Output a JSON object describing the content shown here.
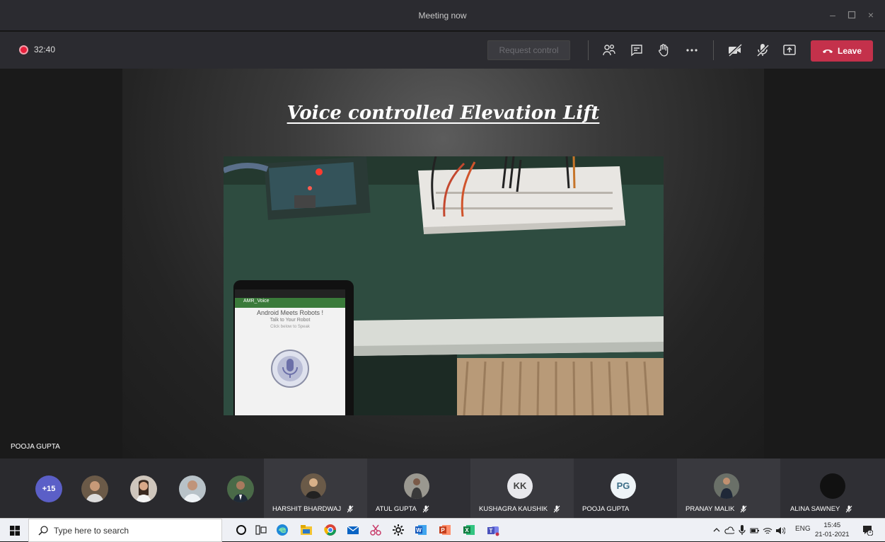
{
  "window": {
    "title": "Meeting now"
  },
  "toolbar": {
    "timer": "32:40",
    "request_control_label": "Request control",
    "leave_label": "Leave",
    "accent_leave": "#c4314b"
  },
  "stage": {
    "slide_title": "Voice controlled Elevation Lift",
    "speaker_name": "POOJA GUPTA",
    "phone": {
      "app_title": "AMR_Voice",
      "heading": "Android Meets Robots !",
      "subheading": "Talk to Your Robot",
      "hint": "Click below to Speak"
    }
  },
  "participants": {
    "overflow_count": "+15",
    "tiles": [
      {
        "name": "HARSHIT BHARDWAJ",
        "initials": "",
        "muted": true
      },
      {
        "name": "ATUL GUPTA",
        "initials": "",
        "muted": true
      },
      {
        "name": "KUSHAGRA KAUSHIK",
        "initials": "KK",
        "muted": true
      },
      {
        "name": "POOJA GUPTA",
        "initials": "PG",
        "muted": false
      },
      {
        "name": "PRANAY MALIK",
        "initials": "",
        "muted": true
      },
      {
        "name": "ALINA SAWNEY",
        "initials": "",
        "muted": true
      }
    ]
  },
  "taskbar": {
    "search_placeholder": "Type here to search",
    "language": "ENG",
    "time": "15:45",
    "date": "21-01-2021",
    "notification_count": "1"
  }
}
